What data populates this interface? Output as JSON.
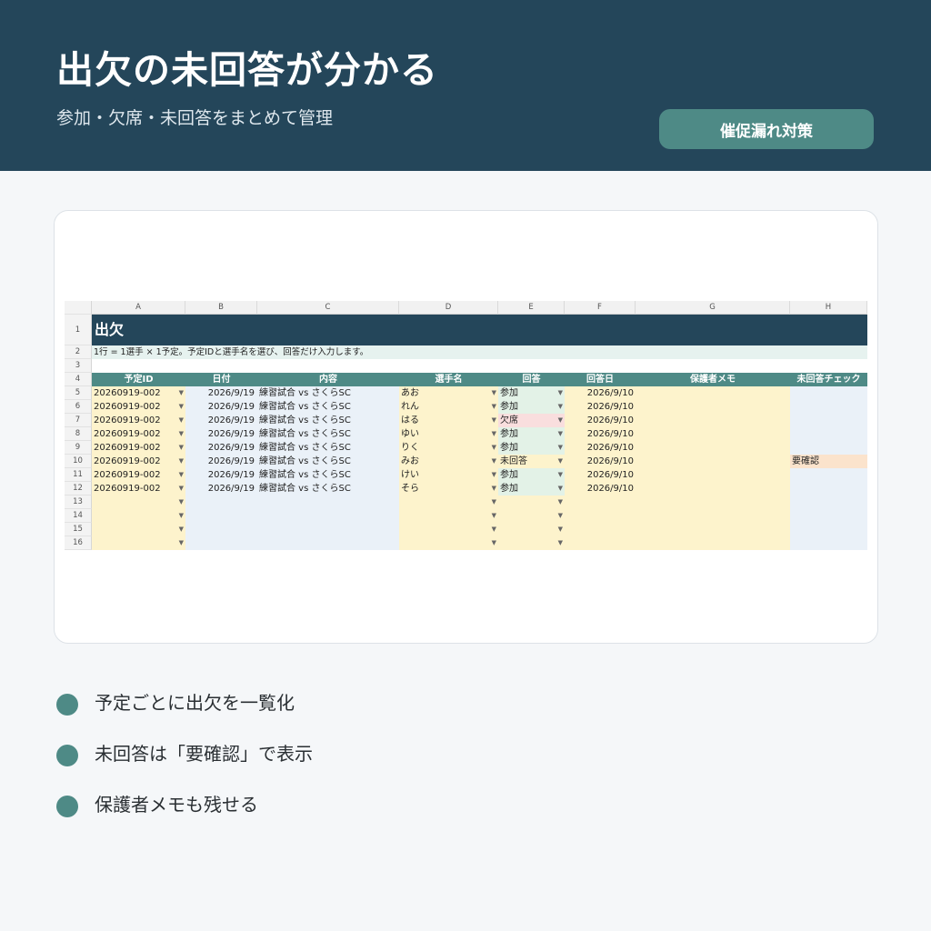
{
  "header": {
    "title": "出欠の未回答が分かる",
    "subtitle": "参加・欠席・未回答をまとめて管理",
    "badge": "催促漏れ対策"
  },
  "sheet": {
    "columns": [
      "A",
      "B",
      "C",
      "D",
      "E",
      "F",
      "G",
      "H"
    ],
    "row_numbers": [
      "1",
      "2",
      "3",
      "4",
      "5",
      "6",
      "7",
      "8",
      "9",
      "10",
      "11",
      "12",
      "13",
      "14",
      "15",
      "16"
    ],
    "banner": "出欠",
    "note": "1行 = 1選手 × 1予定。予定IDと選手名を選び、回答だけ入力します。",
    "headers": [
      "予定ID",
      "日付",
      "内容",
      "選手名",
      "回答",
      "回答日",
      "保護者メモ",
      "未回答チェック"
    ],
    "rows": [
      {
        "id": "20260919-002",
        "date": "2026/9/19",
        "content": "練習試合 vs さくらSC",
        "player": "あお",
        "answer": "参加",
        "answer_date": "2026/9/10",
        "memo": "",
        "check": "",
        "status": "join"
      },
      {
        "id": "20260919-002",
        "date": "2026/9/19",
        "content": "練習試合 vs さくらSC",
        "player": "れん",
        "answer": "参加",
        "answer_date": "2026/9/10",
        "memo": "",
        "check": "",
        "status": "join"
      },
      {
        "id": "20260919-002",
        "date": "2026/9/19",
        "content": "練習試合 vs さくらSC",
        "player": "はる",
        "answer": "欠席",
        "answer_date": "2026/9/10",
        "memo": "",
        "check": "",
        "status": "absent"
      },
      {
        "id": "20260919-002",
        "date": "2026/9/19",
        "content": "練習試合 vs さくらSC",
        "player": "ゆい",
        "answer": "参加",
        "answer_date": "2026/9/10",
        "memo": "",
        "check": "",
        "status": "join"
      },
      {
        "id": "20260919-002",
        "date": "2026/9/19",
        "content": "練習試合 vs さくらSC",
        "player": "りく",
        "answer": "参加",
        "answer_date": "2026/9/10",
        "memo": "",
        "check": "",
        "status": "join"
      },
      {
        "id": "20260919-002",
        "date": "2026/9/19",
        "content": "練習試合 vs さくらSC",
        "player": "みお",
        "answer": "未回答",
        "answer_date": "2026/9/10",
        "memo": "",
        "check": "要確認",
        "status": "none"
      },
      {
        "id": "20260919-002",
        "date": "2026/9/19",
        "content": "練習試合 vs さくらSC",
        "player": "けい",
        "answer": "参加",
        "answer_date": "2026/9/10",
        "memo": "",
        "check": "",
        "status": "join"
      },
      {
        "id": "20260919-002",
        "date": "2026/9/19",
        "content": "練習試合 vs さくらSC",
        "player": "そら",
        "answer": "参加",
        "answer_date": "2026/9/10",
        "memo": "",
        "check": "",
        "status": "join"
      }
    ],
    "empty_row_count": 4,
    "dropdown_icon": "triangle-down-icon"
  },
  "bullets": [
    "予定ごとに出欠を一覧化",
    "未回答は「要確認」で表示",
    "保護者メモも残せる"
  ],
  "colors": {
    "header_bg": "#24465a",
    "accent": "#4e8a86",
    "join": "#e3f2e7",
    "absent": "#f9dede",
    "unanswered": "#fdf3cc",
    "check": "#fbe3cc"
  }
}
